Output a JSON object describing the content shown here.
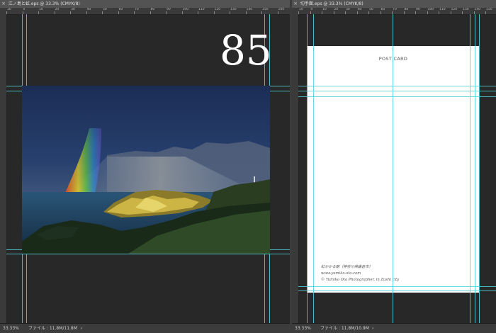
{
  "left_document": {
    "tab_title": "江ノ島と虹.eps @ 33.3% (CMYK/8)",
    "close_glyph": "×",
    "ruler_ticks": [
      "10",
      "0",
      "10",
      "20",
      "30",
      "40",
      "50",
      "60",
      "70",
      "80",
      "90",
      "100",
      "110",
      "120",
      "130",
      "140",
      "150",
      "160"
    ],
    "page_number": "85",
    "zoom": "33.33%",
    "file_info": "ファイル : 11.8M/11.8M",
    "status_arrow": "›"
  },
  "right_document": {
    "tab_title": "切手面.eps @ 33.3% (CMYK/8)",
    "close_glyph": "×",
    "ruler_ticks": [
      "10",
      "0",
      "10",
      "20",
      "30",
      "40",
      "50",
      "60",
      "70",
      "80",
      "90",
      "100",
      "110",
      "120",
      "130",
      "140",
      "150"
    ],
    "card_title": "POST CARD",
    "credit_line_1": "虹かかる朝（神奈川県鎌倉市）",
    "credit_line_2": "www.yumiko-ota.com",
    "credit_line_3": "© Yumiko Ota Photographer, in Zushi city",
    "zoom": "33.33%",
    "file_info": "ファイル : 11.8M/10.9M",
    "status_arrow": "›"
  },
  "colors": {
    "guide": "#4fd1d9",
    "canvas_bg": "#282828",
    "panel_bg": "#535353"
  }
}
